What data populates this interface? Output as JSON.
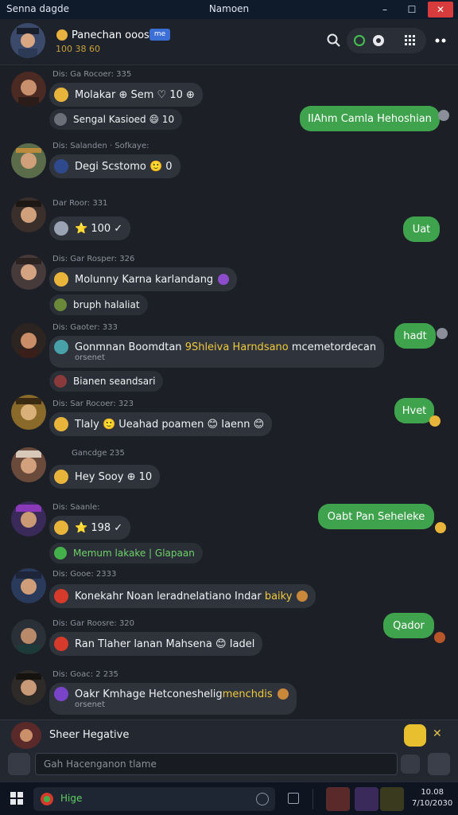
{
  "window": {
    "app_title": "Senna dagde",
    "title": "Namoen",
    "min_glyph": "–",
    "max_glyph": "☐",
    "close_glyph": "✕"
  },
  "header": {
    "contact_name": "Panechan ooose",
    "chip": "me",
    "status": "100 38 60"
  },
  "messages": [
    {
      "sender": "Dis: Ga Rocoer: 335",
      "lines": [
        {
          "text": "Molakar ⊕ Sem ♡ 10 ⊕"
        },
        {
          "text": "Sengal Kasioed 😄 10"
        }
      ]
    },
    {
      "sender": "Dis: Salanden · Sofkaye:",
      "lines": [
        {
          "text": "Degi Scstomo 🙂 0"
        }
      ]
    },
    {
      "sender": "Dar Roor: 331",
      "lines": [
        {
          "text": "⭐ 100 ✓"
        }
      ]
    },
    {
      "sender": "Dis: Gar Rosper: 326",
      "lines": [
        {
          "text": "Molunny Karna karlandang"
        },
        {
          "text": "bruph halaliat"
        }
      ]
    },
    {
      "sender": "Dis: Gaoter: 333",
      "lines": [
        {
          "text_a": "Gonmnan Boomdtan ",
          "text_hl": "9Shleiva Harndsano",
          "text_b": " mcemetordecan",
          "sub": "orsenet"
        },
        {
          "text": "Bianen seandsari"
        }
      ]
    },
    {
      "sender": "Dis: Sar Rocoer: 323",
      "lines": [
        {
          "text": "Tlaly 🙂 Ueahad poamen 😊 Iaenn 😊"
        }
      ]
    },
    {
      "sender": "Gancdge 235",
      "lines": [
        {
          "text": "Hey Sooy ⊕ 10"
        }
      ]
    },
    {
      "sender": "Dis: Saanle:",
      "lines": [
        {
          "text": "⭐ 198 ✓"
        },
        {
          "text": "Memum lakake | Glapaan"
        }
      ]
    },
    {
      "sender": "Dis: Gooe: 2333",
      "lines": [
        {
          "text_a": "Konekahr Noan leradnelatiano Indar ",
          "text_hl": "baiky",
          "text_b": ""
        }
      ]
    },
    {
      "sender": "Dis: Gar Roosre: 320",
      "lines": [
        {
          "text": "Ran Tlaher lanan Mahsena 😊 Iadel"
        }
      ]
    },
    {
      "sender": "Dis: Goac: 2 235",
      "lines": [
        {
          "text_a": "Oakr Kmhage Hetconeshelig",
          "text_hl": "menchdis",
          "text_b": "",
          "sub": "orsenet"
        }
      ]
    }
  ],
  "outgoing": [
    {
      "text": "IIAhm Camla Hehoshian"
    },
    {
      "text": "Uat"
    },
    {
      "text": "hadt"
    },
    {
      "text": "Hvet"
    },
    {
      "text": "Oabt Pan Seheleke"
    },
    {
      "text": "Qador"
    }
  ],
  "composer": {
    "reply_label": "Sheer Hegative",
    "placeholder": "Gah Hacenganon tlame"
  },
  "taskbar": {
    "search_label": "Hige",
    "time": "10.08",
    "date": "7/10/2030"
  },
  "colors": {
    "accent_green": "#3fa34d",
    "bubble_dark": "#2f333c",
    "highlight_yellow": "#f0c93c",
    "close_red": "#d83b3b"
  }
}
